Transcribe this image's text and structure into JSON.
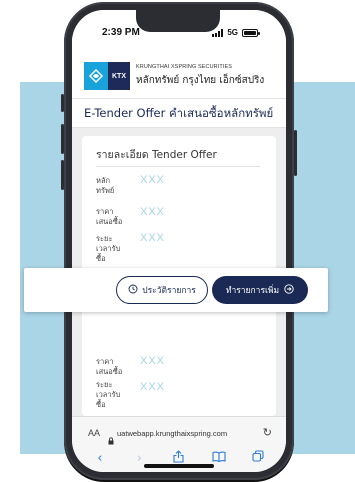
{
  "status": {
    "time": "2:39 PM",
    "network": "5G"
  },
  "brand": {
    "logo_text": "KTX",
    "name_en": "KRUNGTHAI XSPRING SECURITIES",
    "name_th": "หลักทรัพย์ กรุงไทย เอ็กซ์สปริง"
  },
  "page": {
    "title": "E-Tender Offer คำเสนอซื้อหลักทรัพย์"
  },
  "card": {
    "title": "รายละเอียด Tender Offer",
    "rows_top": [
      {
        "label": "หลักทรัพย์",
        "value": "XXX"
      },
      {
        "label": "ราคาเสนอซื้อ",
        "value": "XXX"
      },
      {
        "label": "ระยะเวลารับซื้อ",
        "value": "XXX"
      }
    ],
    "rows_bottom": [
      {
        "label": "ราคาเสนอซื้อ",
        "value": "XXX"
      },
      {
        "label": "ระยะเวลารับซื้อ",
        "value": "XXX"
      }
    ]
  },
  "actions": {
    "history_label": "ประวัติรายการ",
    "add_label": "ทำรายการเพิ่ม"
  },
  "browser": {
    "aa": "AA",
    "url": "uatwebapp.krungthaixspring.com"
  },
  "colors": {
    "navy": "#1a2a55",
    "accent_light_blue": "#a9d5e6",
    "value_blue": "#a6d3ec",
    "ktb_blue": "#1aa3da"
  }
}
